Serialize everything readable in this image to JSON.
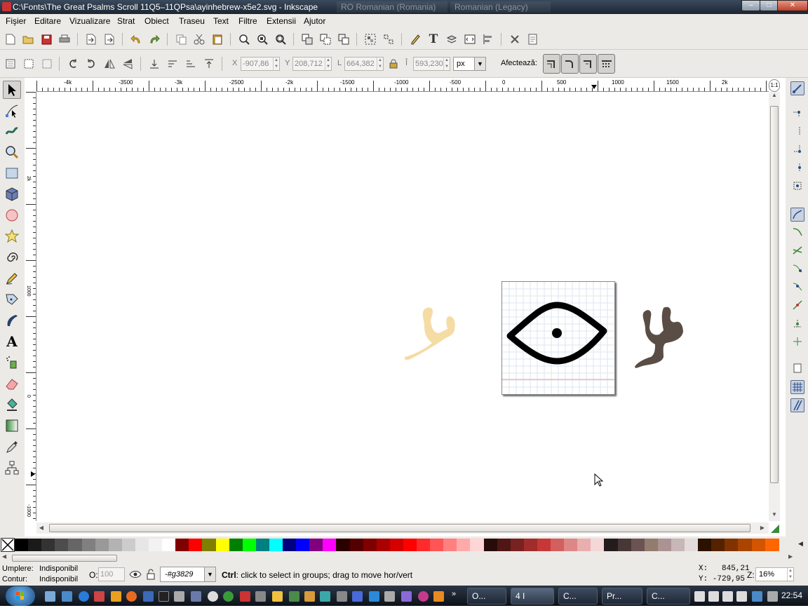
{
  "window": {
    "title": "C:\\Fonts\\The Great Psalms Scroll 11Q5–11QPsa\\ayinhebrew-x5e2.svg - Inkscape",
    "lang_indicator_1": "RO Romanian (Romania)",
    "lang_indicator_2": "Romanian (Legacy)",
    "minimize": "–",
    "maximize": "□",
    "close": "✕"
  },
  "menu": {
    "items": [
      "Fişier",
      "Editare",
      "Vizualizare",
      "Strat",
      "Obiect",
      "Traseu",
      "Text",
      "Filtre",
      "Extensii",
      "Ajutor"
    ]
  },
  "controls": {
    "x_label": "X",
    "x_value": "-907,86",
    "y_label": "Y",
    "y_value": "208,712",
    "w_label": "L",
    "w_value": "664,382",
    "h_label": "Î",
    "h_value": "593,230",
    "unit": "px",
    "affect_label": "Afectează:"
  },
  "ruler": {
    "h_labels": [
      "-4k",
      "-3500",
      "-3k",
      "-2500",
      "-2k",
      "-1500",
      "-1000",
      "-500",
      "0",
      "500",
      "1000",
      "1500",
      "2k"
    ],
    "v_labels": [
      "2k",
      "1000",
      "0",
      "-1000"
    ],
    "zoom_corner": "1:1"
  },
  "canvas": {
    "glyph_left_color": "#f5dca4",
    "glyph_right_color": "#5a4d46",
    "icon_frame_grid_color": "#dde6ef"
  },
  "palette": {
    "colors": [
      "#000000",
      "#1a1a1a",
      "#333333",
      "#4d4d4d",
      "#666666",
      "#808080",
      "#999999",
      "#b3b3b3",
      "#cccccc",
      "#e6e6e6",
      "#f2f2f2",
      "#ffffff",
      "#800000",
      "#ff0000",
      "#808000",
      "#ffff00",
      "#008000",
      "#00ff00",
      "#008080",
      "#00ffff",
      "#000080",
      "#0000ff",
      "#800080",
      "#ff00ff",
      "#2b0000",
      "#550000",
      "#800000",
      "#aa0000",
      "#d40000",
      "#ff0000",
      "#ff2a2a",
      "#ff5555",
      "#ff8080",
      "#ffaaaa",
      "#ffd5d5",
      "#280b0b",
      "#501616",
      "#782121",
      "#a02c2c",
      "#c83737",
      "#d35f5f",
      "#de8787",
      "#e9afaf",
      "#f4d7d7",
      "#241c1c",
      "#483737",
      "#6c5353",
      "#917c6f",
      "#ac9393",
      "#c8b7b7",
      "#e3dbdb",
      "#2b1100",
      "#552200",
      "#803300",
      "#aa4400",
      "#d45500",
      "#ff6600"
    ]
  },
  "status": {
    "fill_label": "Umplere:",
    "fill_value": "Indisponibil",
    "stroke_label": "Contur:",
    "stroke_value": "Indisponibil",
    "opacity_label": "O:",
    "opacity_value": "100",
    "layer_value": "-#g3829",
    "message_bold": "Ctrl",
    "message": ": click to select in groups; drag to move hor/vert",
    "x_coord": "X:   845,21",
    "y_coord": "Y: -729,95",
    "zoom_label": "Z:",
    "zoom_value": "16%"
  },
  "taskbar": {
    "tasks": [
      "O...",
      "4 I",
      "C...",
      "Pr...",
      "C..."
    ],
    "clock": "22:54"
  }
}
